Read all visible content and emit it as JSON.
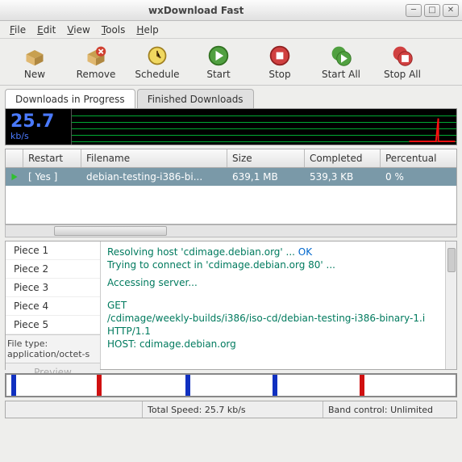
{
  "title": "wxDownload Fast",
  "menu": {
    "file": "File",
    "edit": "Edit",
    "view": "View",
    "tools": "Tools",
    "help": "Help"
  },
  "toolbar": {
    "new": "New",
    "remove": "Remove",
    "schedule": "Schedule",
    "start": "Start",
    "stop": "Stop",
    "startall": "Start All",
    "stopall": "Stop All"
  },
  "tabs": {
    "progress": "Downloads in Progress",
    "finished": "Finished Downloads"
  },
  "speed": {
    "value": "25.7",
    "unit": "kb/s"
  },
  "columns": {
    "restart": "Restart",
    "filename": "Filename",
    "size": "Size",
    "completed": "Completed",
    "percentual": "Percentual"
  },
  "row": {
    "restart": "[ Yes ]",
    "filename": "debian-testing-i386-bi...",
    "size": "639,1 MB",
    "completed": "539,3 KB",
    "percentual": "0 %"
  },
  "pieces": [
    "Piece 1",
    "Piece 2",
    "Piece 3",
    "Piece 4",
    "Piece 5"
  ],
  "filetype_label": "File type:",
  "filetype_value": "application/octet-s",
  "preview": "Preview",
  "log": {
    "l1a": "Resolving host 'cdimage.debian.org' ... ",
    "l1b": "OK",
    "l2": "Trying to connect in 'cdimage.debian.org 80' ...",
    "l3": "Accessing server...",
    "l4": "GET",
    "l5": "/cdimage/weekly-builds/i386/iso-cd/debian-testing-i386-binary-1.i",
    "l6": "HTTP/1.1",
    "l7": "HOST: cdimage.debian.org"
  },
  "status": {
    "totalspeed": "Total Speed: 25.7 kb/s",
    "bandcontrol": "Band control: Unlimited"
  },
  "colors": {
    "accent": "#4a7aff",
    "graphline": "#00aa33",
    "rowbg": "#7a99a8"
  }
}
